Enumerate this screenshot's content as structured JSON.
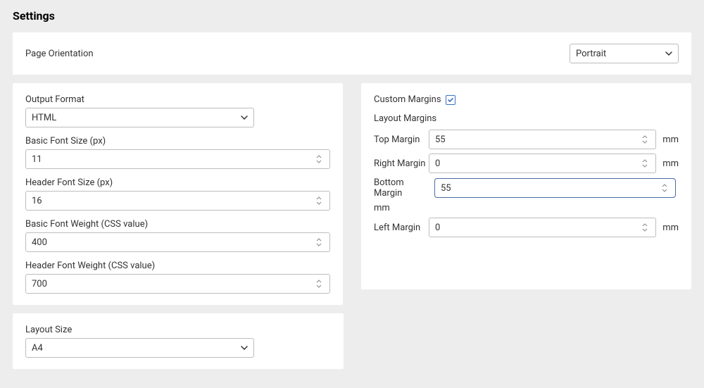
{
  "title": "Settings",
  "orientation": {
    "label": "Page Orientation",
    "value": "Portrait"
  },
  "output_format": {
    "label": "Output Format",
    "value": "HTML"
  },
  "basic_font_size": {
    "label": "Basic Font Size (px)",
    "value": "11"
  },
  "header_font_size": {
    "label": "Header Font Size (px)",
    "value": "16"
  },
  "basic_font_weight": {
    "label": "Basic Font Weight (CSS value)",
    "value": "400"
  },
  "header_font_weight": {
    "label": "Header Font Weight (CSS value)",
    "value": "700"
  },
  "custom_margins_label": "Custom Margins",
  "layout_margins_label": "Layout Margins",
  "margins": {
    "top": {
      "label": "Top Margin",
      "value": "55",
      "unit": "mm"
    },
    "right": {
      "label": "Right Margin",
      "value": "0",
      "unit": "mm"
    },
    "bottom": {
      "label": "Bottom Margin",
      "value": "55",
      "unit": "mm"
    },
    "left": {
      "label": "Left Margin",
      "value": "0",
      "unit": "mm"
    }
  },
  "layout_size": {
    "label": "Layout Size",
    "value": "A4"
  }
}
